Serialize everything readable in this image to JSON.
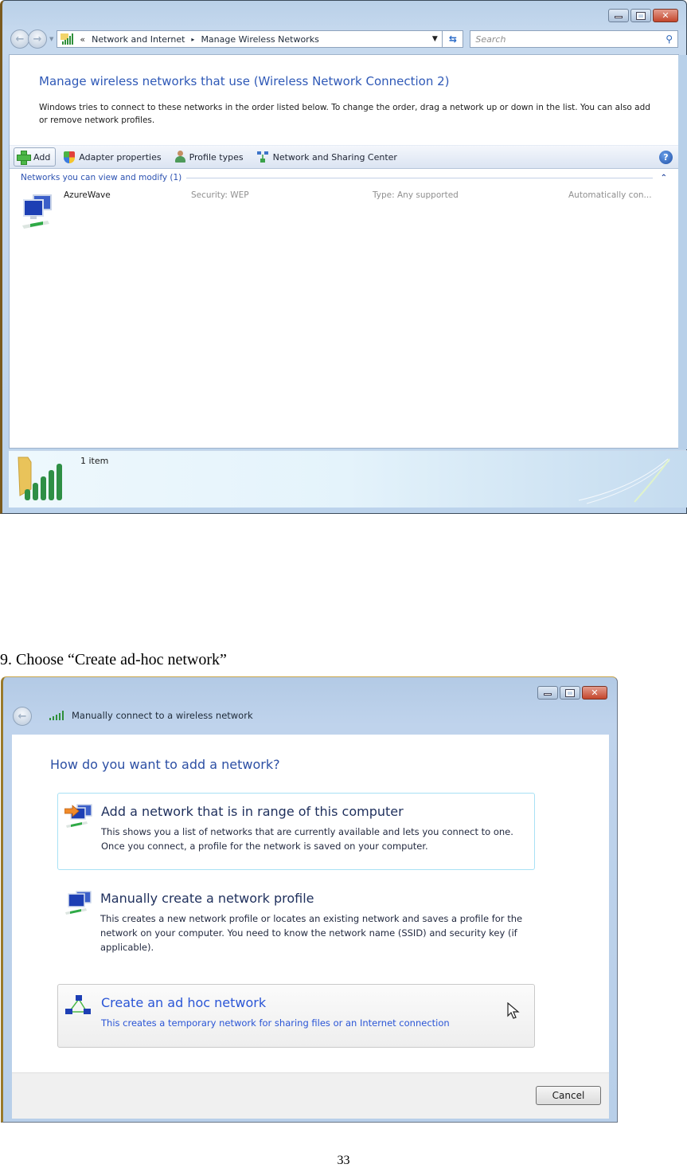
{
  "window1": {
    "breadcrumb": {
      "overflow_glyph": "«",
      "items": [
        "Network and Internet",
        "Manage Wireless Networks"
      ],
      "separator": "▸"
    },
    "search": {
      "placeholder": "Search"
    },
    "heading": "Manage wireless networks that use (Wireless Network Connection 2)",
    "description": "Windows tries to connect to these networks in the order listed below. To change the order, drag a network up or down in the list. You can also add or remove network profiles.",
    "toolbar": {
      "add": "Add",
      "adapter_properties": "Adapter properties",
      "profile_types": "Profile types",
      "network_sharing_center": "Network and Sharing Center",
      "help": "?"
    },
    "group": {
      "title": "Networks you can view and modify (1)",
      "collapse_glyph": "⌃"
    },
    "networks": [
      {
        "name": "AzureWave",
        "security": "Security:  WEP",
        "type": "Type:  Any supported",
        "mode": "Automatically con..."
      }
    ],
    "status": {
      "count": "1 item"
    }
  },
  "caption": "9. Choose “Create ad-hoc network”",
  "window2": {
    "title": "Manually connect to a wireless network",
    "question": "How do you want to add a network?",
    "options": [
      {
        "title": "Add a network that is in range of this computer",
        "description": "This shows you a list of networks that are currently available and lets you connect to one. Once you connect, a profile for the network is saved on your computer.",
        "icon": "network-arrow-icon"
      },
      {
        "title": "Manually create a network profile",
        "description": "This creates a new network profile or locates an existing network and saves a profile for the network on your computer. You need to know the network name (SSID) and security key (if applicable).",
        "icon": "network-computers-icon"
      },
      {
        "title": "Create an ad hoc network",
        "description": "This creates a temporary network for sharing files or an Internet connection",
        "icon": "adhoc-network-icon"
      }
    ],
    "cancel": "Cancel"
  },
  "page_number": "33",
  "colors": {
    "link_blue": "#2f59b7",
    "selected_blue": "#2a55d6",
    "close_red": "#c4462c",
    "aero_frame": "#b9d0e8"
  }
}
